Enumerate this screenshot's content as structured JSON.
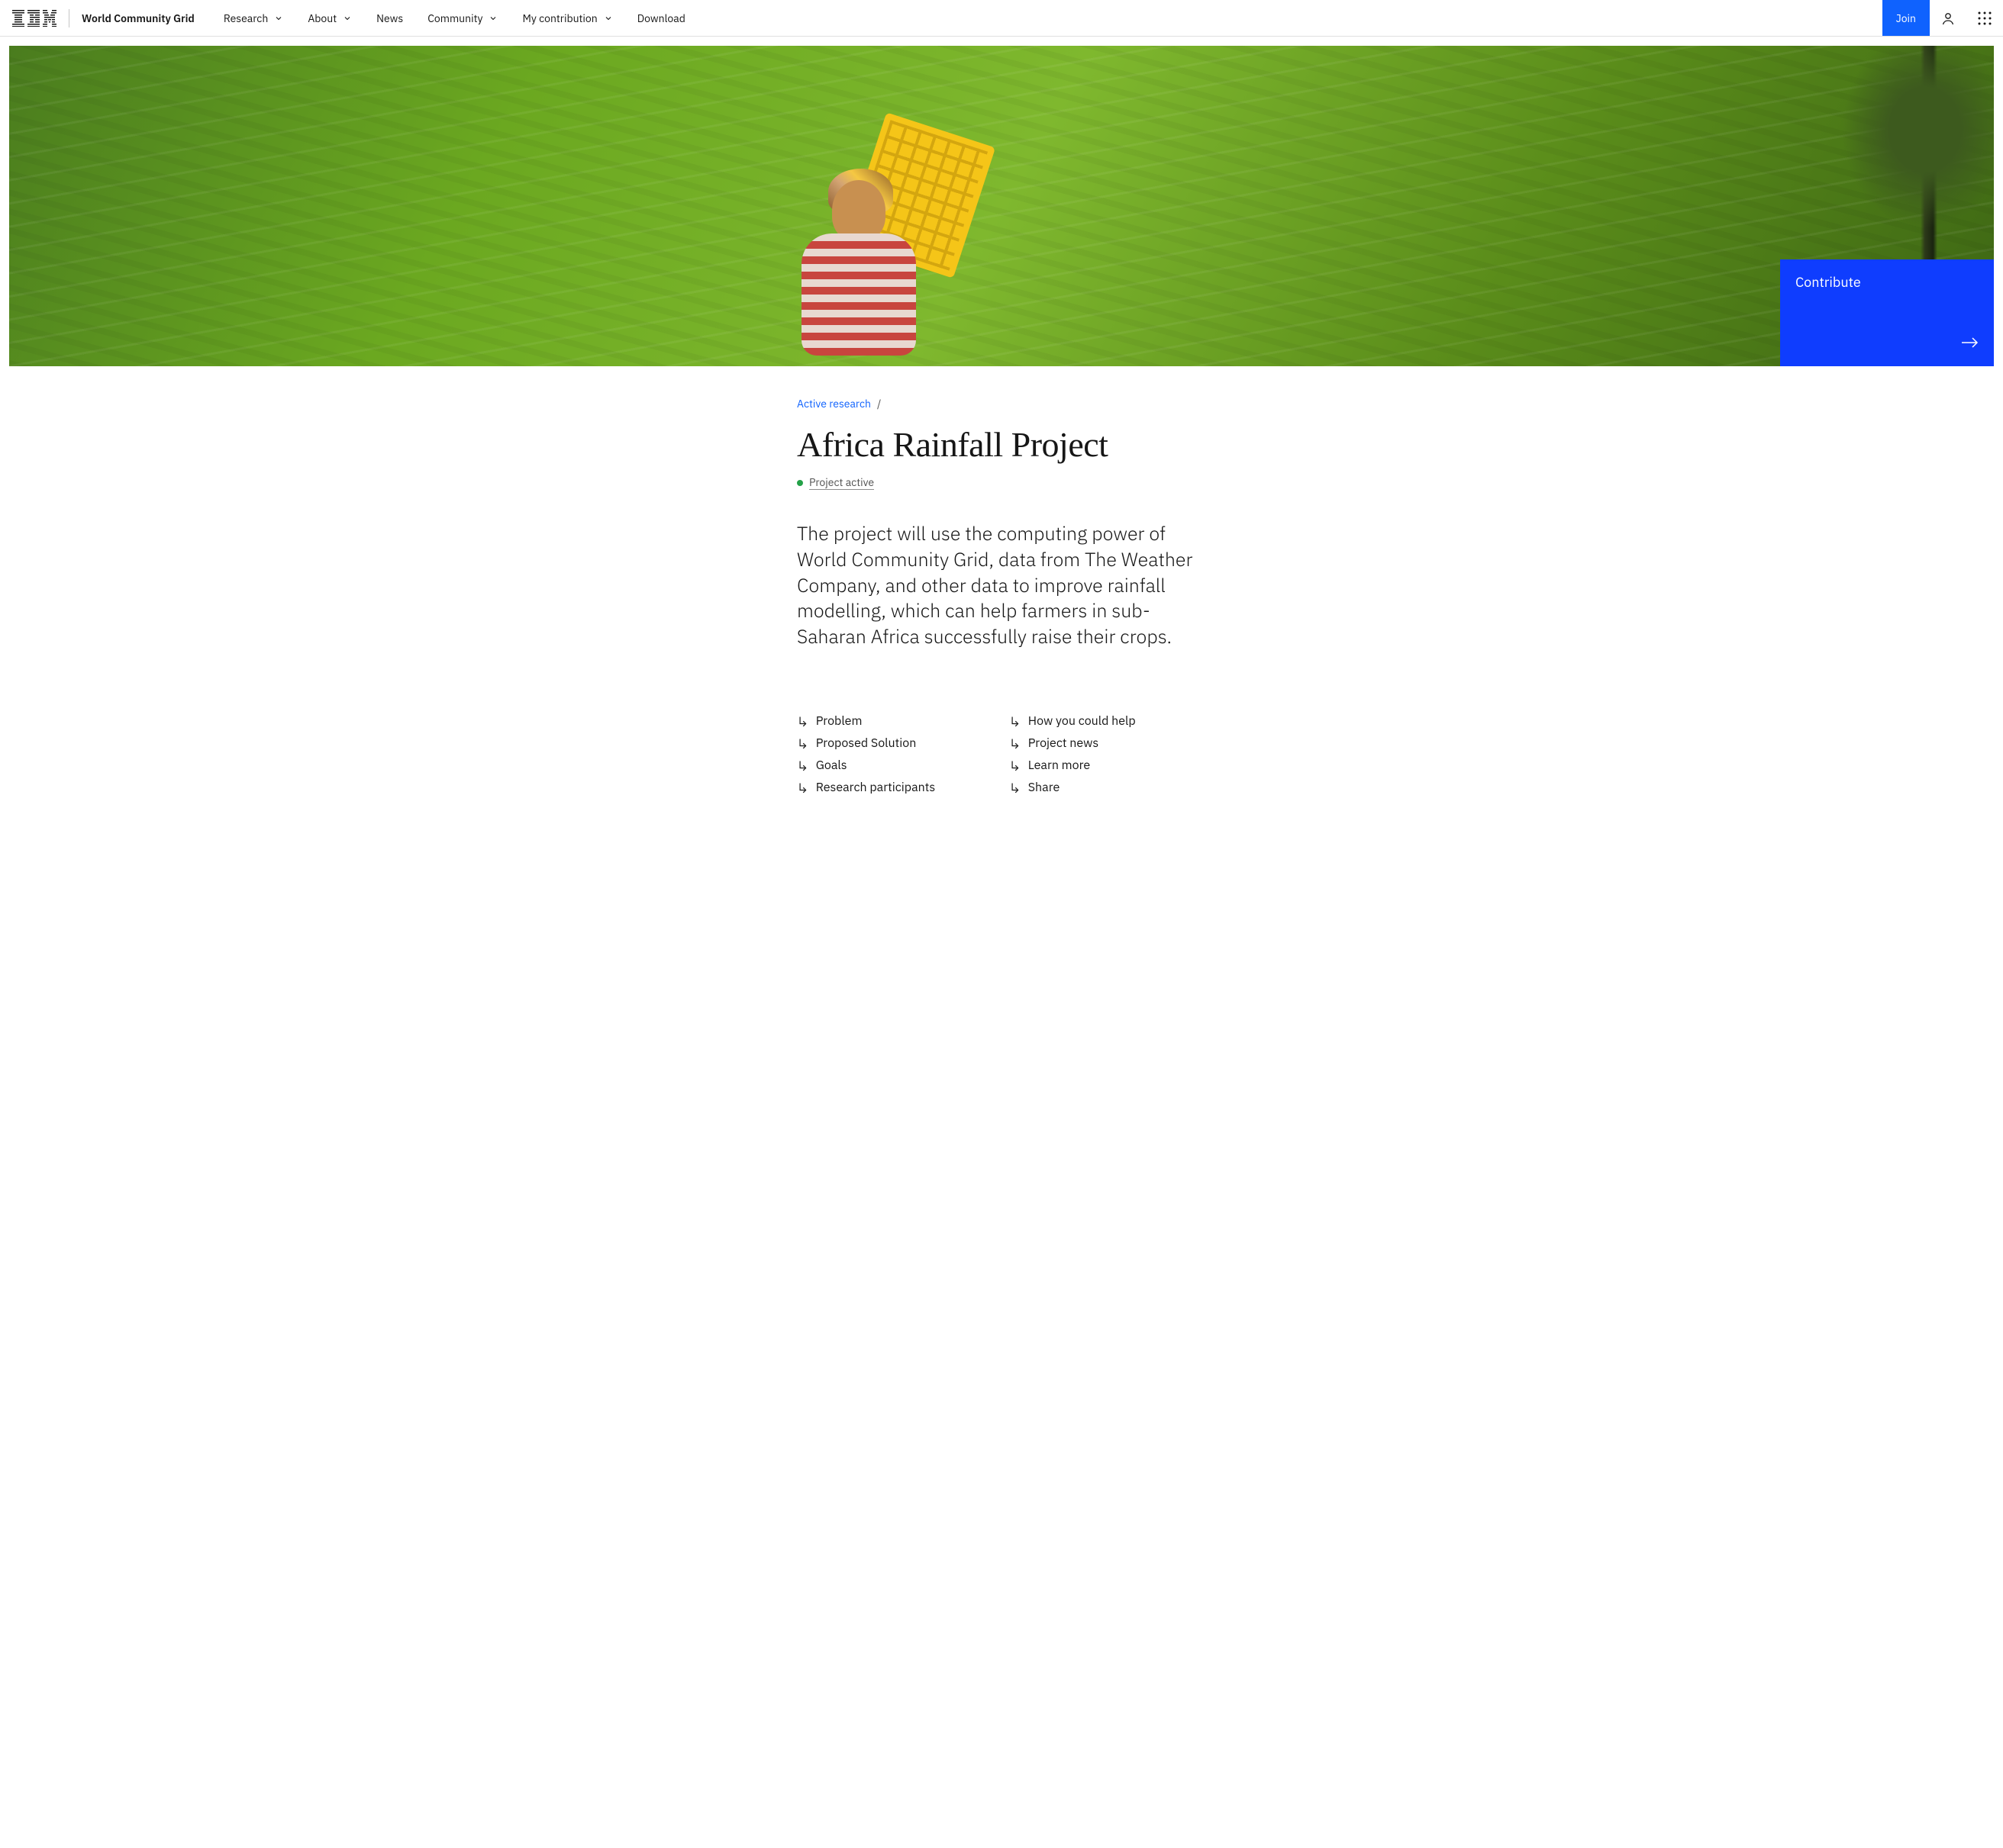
{
  "header": {
    "site_name": "World Community Grid",
    "nav": [
      {
        "label": "Research",
        "dropdown": true
      },
      {
        "label": "About",
        "dropdown": true
      },
      {
        "label": "News",
        "dropdown": false
      },
      {
        "label": "Community",
        "dropdown": true
      },
      {
        "label": "My contribution",
        "dropdown": true
      },
      {
        "label": "Download",
        "dropdown": false
      }
    ],
    "join_label": "Join"
  },
  "hero": {
    "contribute_label": "Contribute"
  },
  "breadcrumb": {
    "parent": "Active research",
    "separator": "/"
  },
  "page": {
    "title": "Africa Rainfall Project",
    "status": "Project active",
    "lead": "The project will use the computing power of World Community Grid, data from The Weather Company, and other data to improve rainfall modelling, which can help farmers in sub-Saharan Africa successfully raise their crops."
  },
  "anchors": {
    "col1": [
      "Problem",
      "Proposed Solution",
      "Goals",
      "Research participants"
    ],
    "col2": [
      "How you could help",
      "Project news",
      "Learn more",
      "Share"
    ]
  }
}
